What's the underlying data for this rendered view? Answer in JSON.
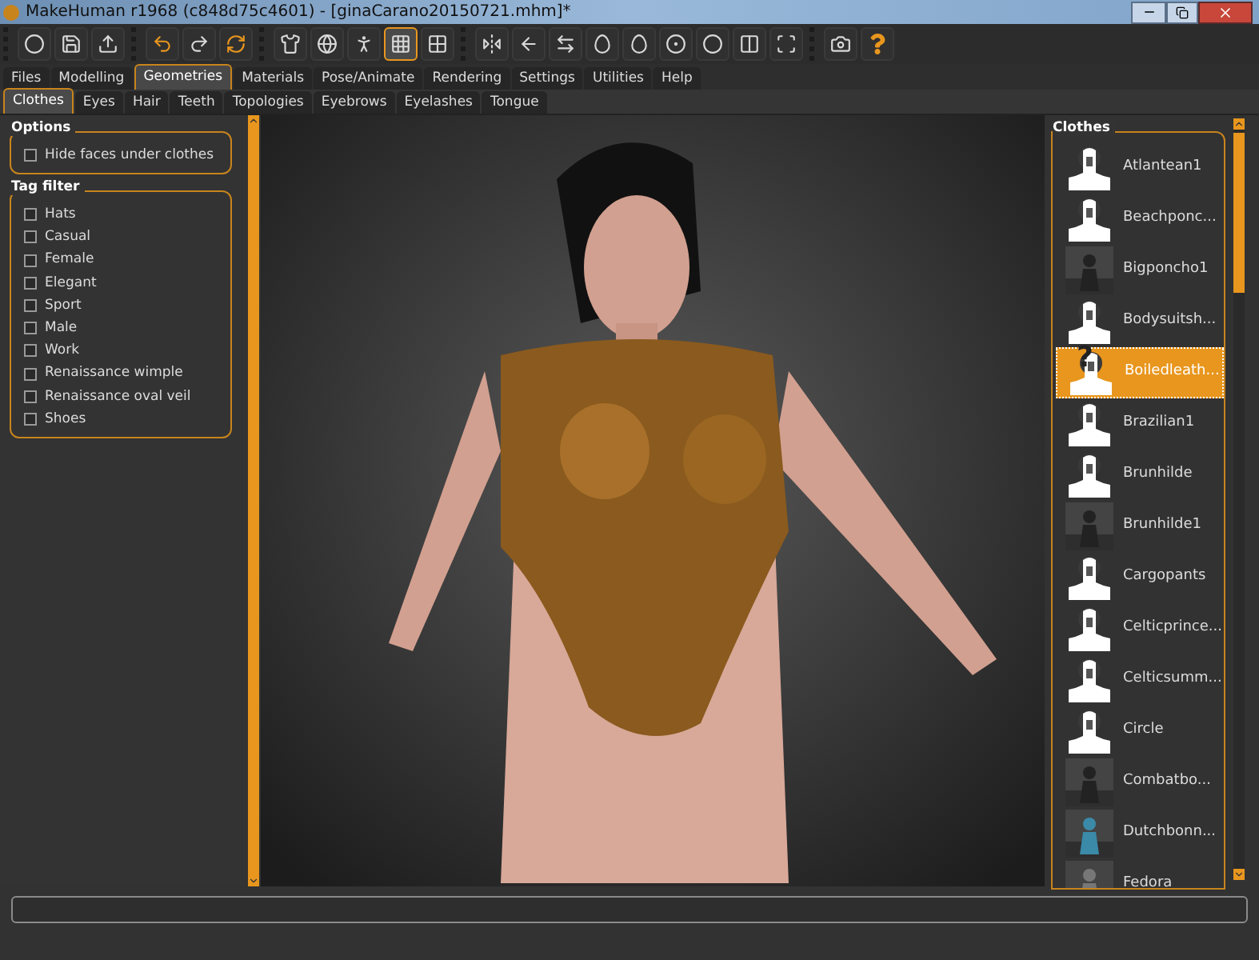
{
  "window": {
    "title": "MakeHuman r1968 (c848d75c4601) - [ginaCarano20150721.mhm]*"
  },
  "toolbar": [
    [
      {
        "selected": false
      },
      {
        "selected": false
      },
      {
        "selected": false
      }
    ],
    [
      {
        "selected": false
      },
      {
        "selected": false
      },
      {
        "selected": false
      }
    ],
    [
      {
        "selected": false
      },
      {
        "selected": false
      },
      {
        "selected": false
      },
      {
        "selected": true
      },
      {
        "selected": false
      }
    ],
    [
      {
        "selected": false
      },
      {
        "selected": false
      },
      {
        "selected": false
      },
      {
        "selected": false
      },
      {
        "selected": false
      },
      {
        "selected": false
      },
      {
        "selected": false
      },
      {
        "selected": false
      },
      {
        "selected": false
      }
    ],
    [
      {
        "selected": false
      },
      {
        "selected": false
      }
    ]
  ],
  "menu_tabs": [
    {
      "label": "Files",
      "selected": false
    },
    {
      "label": "Modelling",
      "selected": false
    },
    {
      "label": "Geometries",
      "selected": true
    },
    {
      "label": "Materials",
      "selected": false
    },
    {
      "label": "Pose/Animate",
      "selected": false
    },
    {
      "label": "Rendering",
      "selected": false
    },
    {
      "label": "Settings",
      "selected": false
    },
    {
      "label": "Utilities",
      "selected": false
    },
    {
      "label": "Help",
      "selected": false
    }
  ],
  "sub_tabs": [
    {
      "label": "Clothes",
      "selected": true
    },
    {
      "label": "Eyes",
      "selected": false
    },
    {
      "label": "Hair",
      "selected": false
    },
    {
      "label": "Teeth",
      "selected": false
    },
    {
      "label": "Topologies",
      "selected": false
    },
    {
      "label": "Eyebrows",
      "selected": false
    },
    {
      "label": "Eyelashes",
      "selected": false
    },
    {
      "label": "Tongue",
      "selected": false
    }
  ],
  "options": {
    "title": "Options",
    "items": [
      {
        "label": "Hide faces under clothes",
        "checked": false
      }
    ]
  },
  "tag_filter": {
    "title": "Tag filter",
    "items": [
      {
        "label": "Hats",
        "checked": false
      },
      {
        "label": "Casual",
        "checked": false
      },
      {
        "label": "Female",
        "checked": false
      },
      {
        "label": "Elegant",
        "checked": false
      },
      {
        "label": "Sport",
        "checked": false
      },
      {
        "label": "Male",
        "checked": false
      },
      {
        "label": "Work",
        "checked": false
      },
      {
        "label": "Renaissance wimple",
        "checked": false
      },
      {
        "label": "Renaissance oval veil",
        "checked": false
      },
      {
        "label": "Shoes",
        "checked": false
      }
    ]
  },
  "clothes": {
    "title": "Clothes",
    "items": [
      {
        "label": "Atlantean1",
        "kind": "placeholder",
        "selected": false
      },
      {
        "label": "Beachponc...",
        "kind": "placeholder",
        "selected": false
      },
      {
        "label": "Bigponcho1",
        "kind": "picture",
        "selected": false
      },
      {
        "label": "Bodysuitsh...",
        "kind": "placeholder",
        "selected": false
      },
      {
        "label": "Boiledleath...",
        "kind": "unknown",
        "badge": "?",
        "selected": true
      },
      {
        "label": "Brazilian1",
        "kind": "placeholder",
        "selected": false
      },
      {
        "label": "Brunhilde",
        "kind": "placeholder",
        "selected": false
      },
      {
        "label": "Brunhilde1",
        "kind": "picture",
        "selected": false
      },
      {
        "label": "Cargopants",
        "kind": "placeholder",
        "selected": false
      },
      {
        "label": "Celticprince...",
        "kind": "placeholder",
        "selected": false
      },
      {
        "label": "Celticsumm...",
        "kind": "placeholder",
        "selected": false
      },
      {
        "label": "Circle",
        "kind": "placeholder",
        "selected": false
      },
      {
        "label": "Combatbo...",
        "kind": "picture",
        "selected": false
      },
      {
        "label": "Dutchbonn...",
        "kind": "picture",
        "selected": false
      },
      {
        "label": "Fedora",
        "kind": "picture",
        "selected": false
      }
    ]
  }
}
